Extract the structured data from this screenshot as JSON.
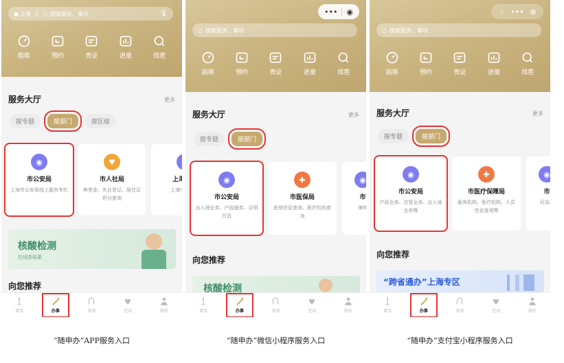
{
  "panels": [
    {
      "location": "上海",
      "search_placeholder": "搜索服务、事项",
      "icons": [
        "指南",
        "预约",
        "亮证",
        "进度",
        "找茬"
      ],
      "hall_title": "服务大厅",
      "more": "更多",
      "tabs": [
        "按专题",
        "按部门",
        "按区级"
      ],
      "active_tab": 1,
      "cards": [
        {
          "name": "市公安局",
          "desc": "上海市公安局线上服务专栏",
          "icon": "police-icon",
          "color": "blue"
        },
        {
          "name": "市人社局",
          "desc": "养老金、失业登记、居住证积分查询",
          "icon": "people-icon",
          "color": "orange"
        },
        {
          "name": "上海市教",
          "desc": "上海市教育局",
          "icon": "edu-icon",
          "color": "blue"
        }
      ],
      "banner_title": "核酸检测",
      "banner_sub": "在线查结果",
      "recommend": "向您推荐",
      "nav": [
        "首页",
        "办事",
        "发现",
        "互动",
        "我的"
      ],
      "caption": "“随申办”APP服务入口"
    },
    {
      "search_placeholder": "搜索服务、事项",
      "icons": [
        "指南",
        "预约",
        "亮证",
        "进度",
        "找茬"
      ],
      "hall_title": "服务大厅",
      "more": "更多",
      "tabs": [
        "按专题",
        "按部门"
      ],
      "active_tab": 1,
      "cards": [
        {
          "name": "市公安局",
          "desc": "出入境业务、户政服务、证明开具",
          "icon": "police-icon",
          "color": "blue"
        },
        {
          "name": "市医保局",
          "desc": "医保信息查询、医疗机构查询",
          "icon": "medical-icon",
          "color": "red"
        },
        {
          "name": "市",
          "desc": "律师",
          "icon": "law-icon",
          "color": "blue"
        }
      ],
      "recommend": "向您推荐",
      "banner_title": "核酸检测",
      "nav": [
        "首页",
        "办事",
        "发现",
        "互动",
        "我的"
      ],
      "caption": "“随申办”微信小程序服务入口"
    },
    {
      "search_placeholder": "搜索服务、事项",
      "icons": [
        "指南",
        "预约",
        "亮证",
        "进度",
        "找茬"
      ],
      "hall_title": "服务大厅",
      "more": "更多",
      "tabs": [
        "按专题",
        "按部门"
      ],
      "active_tab": 1,
      "cards": [
        {
          "name": "市公安局",
          "desc": "户政业务、交管业务、出入境业务等",
          "icon": "police-icon",
          "color": "blue"
        },
        {
          "name": "市医疗保障局",
          "desc": "服务机构、医疗机构、人员信息查询等",
          "icon": "medical-icon",
          "color": "red"
        },
        {
          "name": "市",
          "desc": "司法类",
          "icon": "law-icon",
          "color": "blue"
        }
      ],
      "recommend": "向您推荐",
      "banner_title": "“跨省通办”上海专区",
      "nav": [
        "首页",
        "办事",
        "发现",
        "互动",
        "我的"
      ],
      "caption": "“随申办”支付宝小程序服务入口"
    }
  ],
  "colors": {
    "accent": "#c6a96e",
    "highlight_box": "#e53333",
    "nav_active": "#c99c3f"
  }
}
